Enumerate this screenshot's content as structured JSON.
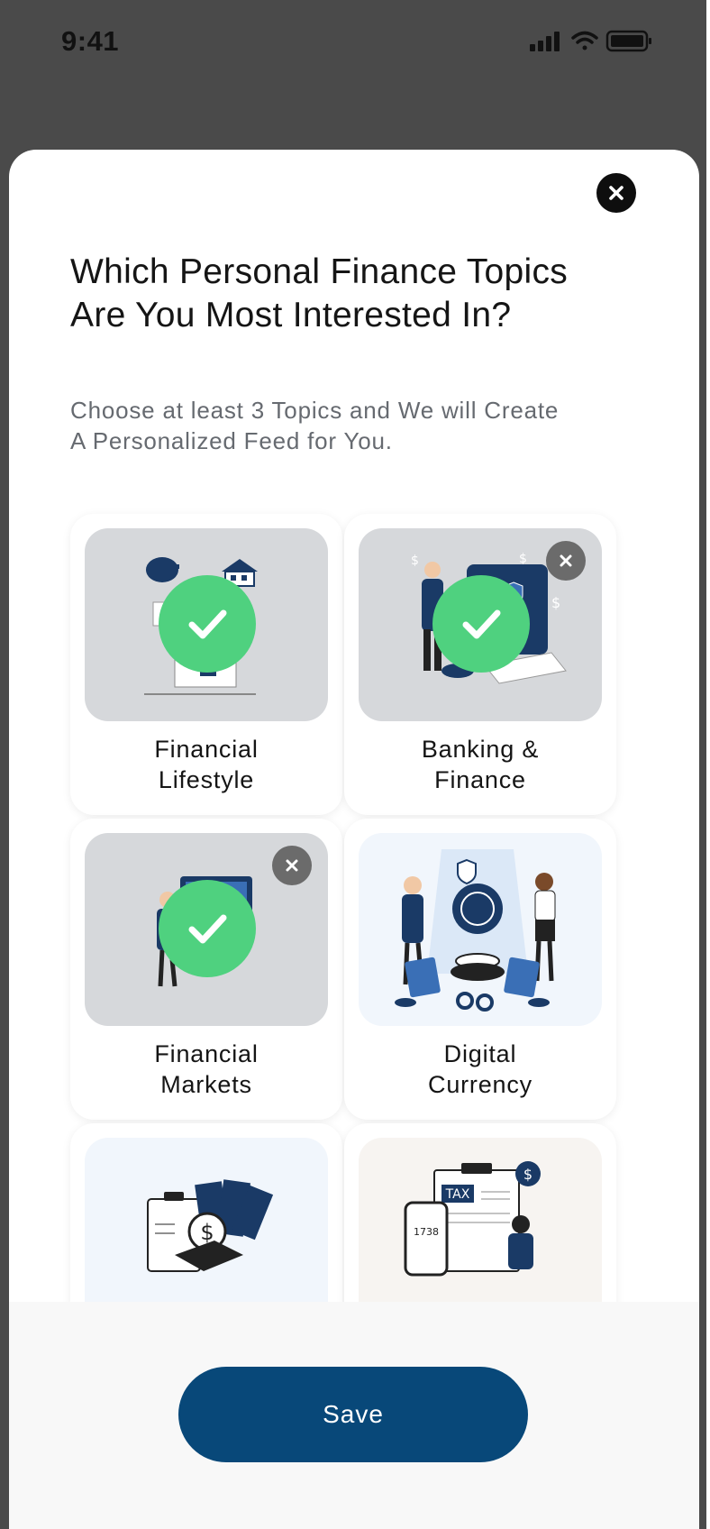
{
  "status_bar": {
    "time": "9:41"
  },
  "modal": {
    "title": "Which Personal Finance Topics Are You Most Interested In?",
    "subtitle": "Choose at least 3 Topics and We will Create A Personalized Feed for You.",
    "topics": [
      {
        "label": "Financial\nLifestyle",
        "selected": true,
        "removable": false,
        "background": "#d6d8db",
        "icon": "lifestyle-illustration"
      },
      {
        "label": "Banking &\nFinance",
        "selected": true,
        "removable": true,
        "background": "#d6d8db",
        "icon": "banking-illustration"
      },
      {
        "label": "Financial\nMarkets",
        "selected": true,
        "removable": true,
        "background": "#d6d8db",
        "icon": "markets-illustration"
      },
      {
        "label": "Digital\nCurrency",
        "selected": false,
        "removable": false,
        "background": "#f1f6fc",
        "icon": "crypto-illustration"
      },
      {
        "label": "",
        "selected": false,
        "removable": false,
        "background": "#f1f6fc",
        "icon": "budget-illustration"
      },
      {
        "label": "",
        "selected": false,
        "removable": false,
        "background": "#f7f4f1",
        "icon": "tax-illustration"
      }
    ],
    "save_label": "Save"
  },
  "colors": {
    "backdrop": "#4a4a4a",
    "accent": "#084879",
    "check": "#4fd17f",
    "remove": "#6b6b6b"
  }
}
